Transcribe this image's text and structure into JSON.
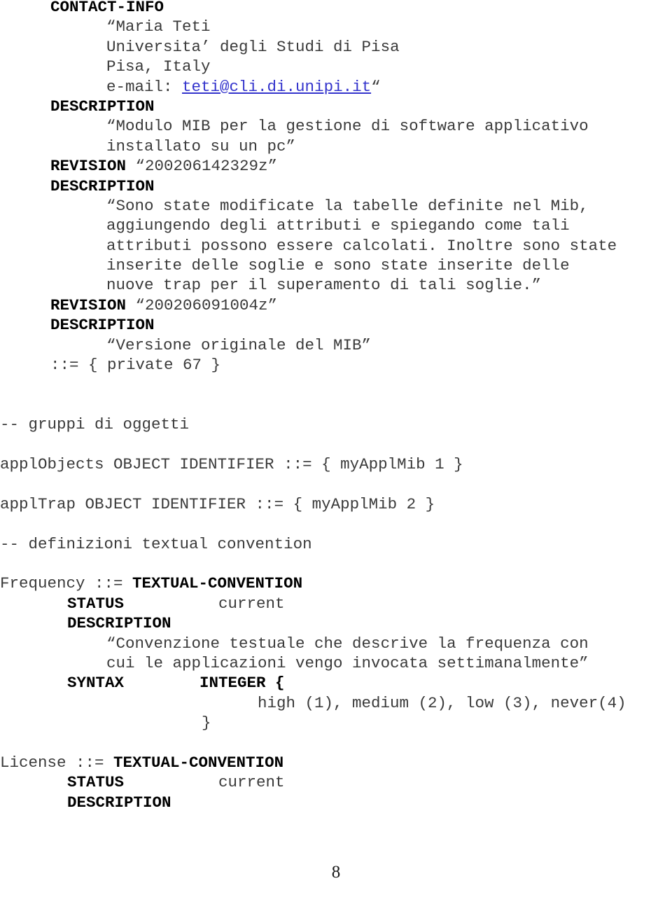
{
  "document": {
    "page_number": "8",
    "link_color": "#3333cc",
    "text_color": "#3a3a3a",
    "keyword_color": "#000000"
  },
  "lines": [
    {
      "indent": "i45",
      "keyword": "CONTACT-INFO",
      "text": ""
    },
    {
      "indent": "i9",
      "keyword": "",
      "text": "“Maria Teti"
    },
    {
      "indent": "i9",
      "keyword": "",
      "text": "Universita’ degli Studi di Pisa"
    },
    {
      "indent": "i9",
      "keyword": "",
      "text": "Pisa, Italy"
    },
    {
      "indent": "i9",
      "keyword": "",
      "text": "e-mail: ",
      "link": "teti@cli.di.unipi.it",
      "after": "“"
    },
    {
      "indent": "i45",
      "keyword": "DESCRIPTION",
      "text": ""
    },
    {
      "indent": "i9",
      "keyword": "",
      "text": "“Modulo MIB per la gestione di software applicativo"
    },
    {
      "indent": "i9",
      "keyword": "",
      "text": "installato su un pc”"
    },
    {
      "indent": "i45",
      "keyword": "REVISION",
      "text": " “200206142329z”"
    },
    {
      "indent": "i45",
      "keyword": "DESCRIPTION",
      "text": ""
    },
    {
      "indent": "i9",
      "keyword": "",
      "text": "“Sono state modificate la tabelle definite nel Mib,"
    },
    {
      "indent": "i9",
      "keyword": "",
      "text": "aggiungendo degli attributi e spiegando come tali"
    },
    {
      "indent": "i9",
      "keyword": "",
      "text": "attributi possono essere calcolati. Inoltre sono state"
    },
    {
      "indent": "i9",
      "keyword": "",
      "text": "inserite delle soglie e sono state inserite delle"
    },
    {
      "indent": "i9",
      "keyword": "",
      "text": "nuove trap per il superamento di tali soglie.”"
    },
    {
      "indent": "i45",
      "keyword": "REVISION",
      "text": " “200206091004z”"
    },
    {
      "indent": "i45",
      "keyword": "DESCRIPTION",
      "text": ""
    },
    {
      "indent": "i9",
      "keyword": "",
      "text": "“Versione originale del MIB”"
    },
    {
      "indent": "i45",
      "keyword": "",
      "text": "::= { private 67 }"
    },
    {
      "indent": "i0",
      "keyword": "",
      "text": "",
      "blank": true
    },
    {
      "indent": "i0",
      "keyword": "",
      "text": "",
      "blank": true
    },
    {
      "indent": "i0",
      "keyword": "",
      "text": "-- gruppi di oggetti"
    },
    {
      "indent": "i0",
      "keyword": "",
      "text": "",
      "blank": true
    },
    {
      "indent": "i0",
      "keyword": "",
      "text": "applObjects OBJECT IDENTIFIER ::= { myApplMib 1 }"
    },
    {
      "indent": "i0",
      "keyword": "",
      "text": "",
      "blank": true
    },
    {
      "indent": "i0",
      "keyword": "",
      "text": "applTrap OBJECT IDENTIFIER ::= { myApplMib 2 }"
    },
    {
      "indent": "i0",
      "keyword": "",
      "text": "",
      "blank": true
    },
    {
      "indent": "i0",
      "keyword": "",
      "text": "-- definizioni textual convention"
    },
    {
      "indent": "i0",
      "keyword": "",
      "text": "",
      "blank": true
    },
    {
      "indent": "i0",
      "pre": "Frequency ::= ",
      "keyword": "TEXTUAL-CONVENTION",
      "text": ""
    },
    {
      "indent": "i6",
      "keyword": "STATUS",
      "text": "          current"
    },
    {
      "indent": "i6",
      "keyword": "DESCRIPTION",
      "text": ""
    },
    {
      "indent": "i9",
      "keyword": "",
      "text": "“Convenzione testuale che descrive la frequenza con"
    },
    {
      "indent": "i9",
      "keyword": "",
      "text": "cui le applicazioni vengo invocata settimanalmente”"
    },
    {
      "indent": "i6",
      "keyword": "SYNTAX        INTEGER {",
      "text": ""
    },
    {
      "indent": "i23",
      "keyword": "",
      "text": "high (1), medium (2), low (3), never(4)"
    },
    {
      "indent": "i18",
      "keyword": "",
      "text": "}"
    },
    {
      "indent": "i0",
      "keyword": "",
      "text": "",
      "blank": true
    },
    {
      "indent": "i0",
      "pre": "License ::= ",
      "keyword": "TEXTUAL-CONVENTION",
      "text": ""
    },
    {
      "indent": "i6",
      "keyword": "STATUS",
      "text": "          current"
    },
    {
      "indent": "i6",
      "keyword": "DESCRIPTION",
      "text": ""
    }
  ]
}
